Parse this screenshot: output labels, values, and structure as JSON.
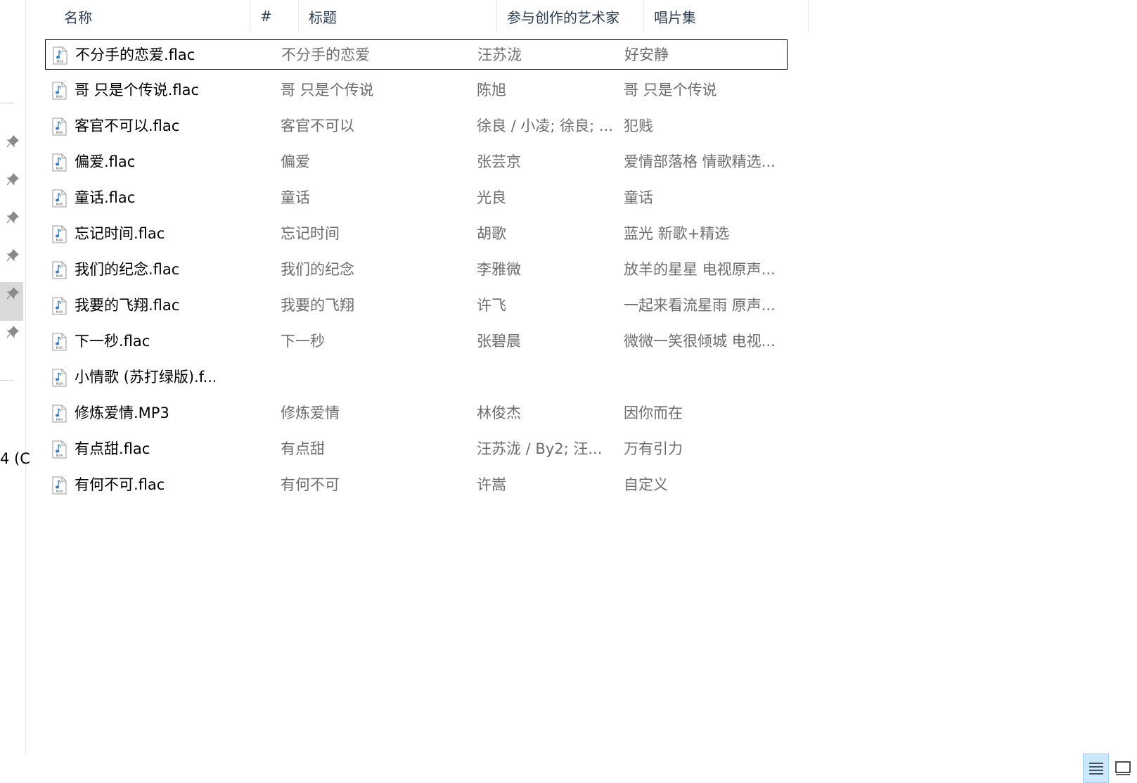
{
  "columns": {
    "name": "名称",
    "track": "#",
    "title": "标题",
    "artists": "参与创作的艺术家",
    "album": "唱片集"
  },
  "nav": {
    "fragment": "4 (C"
  },
  "files": [
    {
      "name": "不分手的恋爱.flac",
      "title": "不分手的恋爱",
      "artist": "汪苏泷",
      "album": "好安静",
      "type": "M4A"
    },
    {
      "name": "哥 只是个传说.flac",
      "title": "哥 只是个传说",
      "artist": "陈旭",
      "album": "哥 只是个传说",
      "type": "M4A"
    },
    {
      "name": "客官不可以.flac",
      "title": "客官不可以",
      "artist": "徐良 / 小凌; 徐良; ...",
      "album": "犯贱",
      "type": "M4A"
    },
    {
      "name": "偏爱.flac",
      "title": "偏爱",
      "artist": "张芸京",
      "album": "爱情部落格 情歌精选...",
      "type": "M4A"
    },
    {
      "name": "童话.flac",
      "title": "童话",
      "artist": "光良",
      "album": "童话",
      "type": "M4A"
    },
    {
      "name": "忘记时间.flac",
      "title": "忘记时间",
      "artist": "胡歌",
      "album": "蓝光 新歌+精选",
      "type": "M4A"
    },
    {
      "name": "我们的纪念.flac",
      "title": "我们的纪念",
      "artist": "李雅微",
      "album": "放羊的星星 电视原声...",
      "type": "M4A"
    },
    {
      "name": "我要的飞翔.flac",
      "title": "我要的飞翔",
      "artist": "许飞",
      "album": "一起来看流星雨 原声...",
      "type": "M4A"
    },
    {
      "name": "下一秒.flac",
      "title": "下一秒",
      "artist": "张碧晨",
      "album": "微微一笑很倾城 电视...",
      "type": "M4A"
    },
    {
      "name": "小情歌 (苏打绿版).f...",
      "title": "",
      "artist": "",
      "album": "",
      "type": "M4A"
    },
    {
      "name": "修炼爱情.MP3",
      "title": "修炼爱情",
      "artist": "林俊杰",
      "album": "因你而在",
      "type": "MP3"
    },
    {
      "name": "有点甜.flac",
      "title": "有点甜",
      "artist": "汪苏泷 / By2; 汪...",
      "album": "万有引力",
      "type": "M4A"
    },
    {
      "name": "有何不可.flac",
      "title": "有何不可",
      "artist": "许嵩",
      "album": "自定义",
      "type": "M4A"
    }
  ],
  "colors": {
    "header_text": "#2b3c55",
    "secondary_text": "#6d6d6d",
    "focus_border": "#000000"
  },
  "icons": {
    "pin": "pin-icon",
    "file": "audio-file-icon",
    "details_view": "details-view-icon",
    "large_icons_view": "large-icons-view-icon"
  }
}
